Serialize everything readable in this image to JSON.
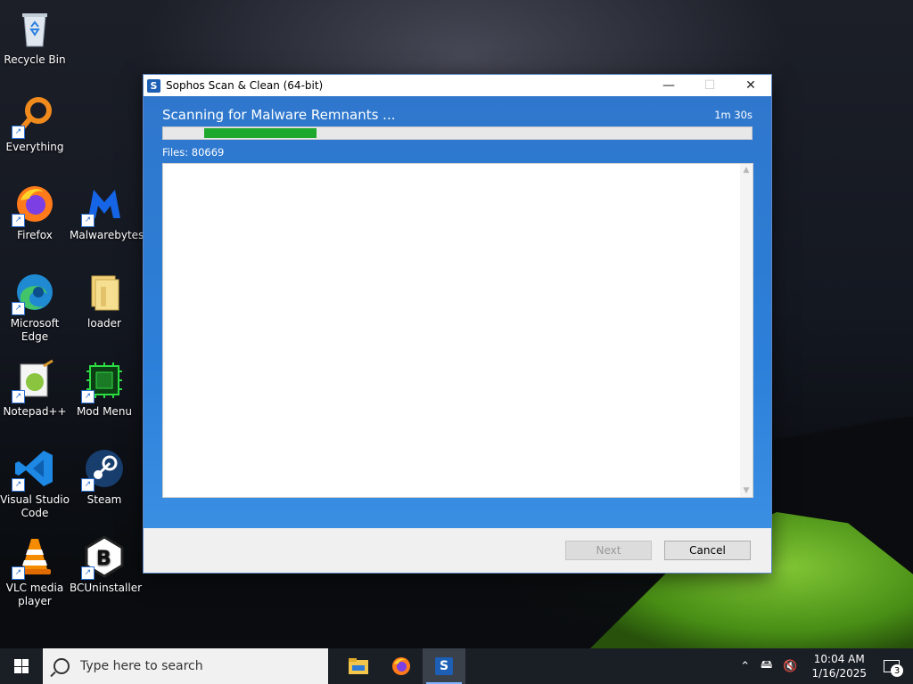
{
  "desktop": {
    "icons": [
      {
        "label": "Recycle Bin",
        "icon": "recycle-bin-icon"
      },
      {
        "label": "Everything",
        "icon": "everything-search-icon"
      },
      {
        "label": "Firefox",
        "icon": "firefox-icon"
      },
      {
        "label": "Malwarebytes",
        "icon": "malwarebytes-icon"
      },
      {
        "label": "Microsoft Edge",
        "icon": "edge-icon"
      },
      {
        "label": "loader",
        "icon": "folder-icon"
      },
      {
        "label": "Notepad++",
        "icon": "notepadpp-icon"
      },
      {
        "label": "Mod Menu",
        "icon": "chip-icon"
      },
      {
        "label": "Visual Studio Code",
        "icon": "vscode-icon"
      },
      {
        "label": "Steam",
        "icon": "steam-icon"
      },
      {
        "label": "VLC media player",
        "icon": "vlc-icon"
      },
      {
        "label": "BCUninstaller",
        "icon": "bcuninstaller-icon"
      }
    ]
  },
  "window": {
    "title": "Sophos Scan & Clean (64-bit)",
    "app_icon_letter": "S",
    "scan_status": "Scanning for Malware Remnants ...",
    "elapsed": "1m 30s",
    "progress_fraction": 0.19,
    "files_label": "Files: 80669",
    "buttons": {
      "next": "Next",
      "cancel": "Cancel"
    }
  },
  "taskbar": {
    "search_placeholder": "Type here to search",
    "pinned": [
      "file-explorer-icon",
      "firefox-icon",
      "sophos-icon"
    ],
    "time": "10:04 AM",
    "date": "1/16/2025",
    "notification_count": "3"
  },
  "colors": {
    "window_blue": "#2f77cd",
    "progress_green": "#1fa82e",
    "taskbar": "#1a1f26"
  }
}
